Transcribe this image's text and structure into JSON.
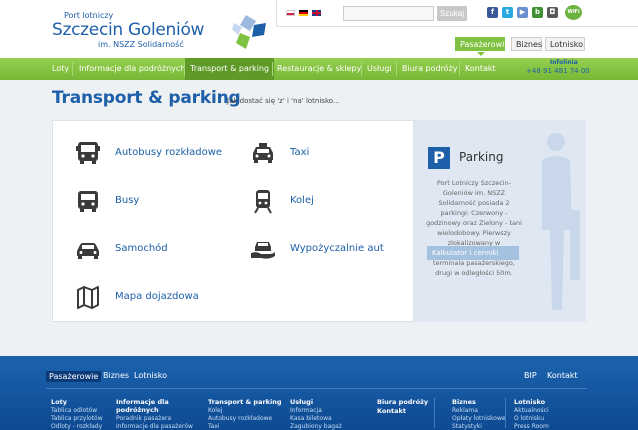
{
  "logo": {
    "line1": "Port lotniczy",
    "line2": "Szczecin Goleniów",
    "line3": "im. NSZZ Solidarność"
  },
  "topbar": {
    "search_placeholder": "",
    "search_button": "Szukaj",
    "social": [
      {
        "name": "facebook-icon",
        "glyph": "f",
        "color": "#3b5998"
      },
      {
        "name": "twitter-icon",
        "glyph": "t",
        "color": "#2aa9e0"
      },
      {
        "name": "youtube-icon",
        "glyph": "▶",
        "color": "#6a8fd0"
      },
      {
        "name": "blogger-icon",
        "glyph": "b",
        "color": "#3d9130"
      },
      {
        "name": "instagram-icon",
        "glyph": "◘",
        "color": "#5a5a5a"
      }
    ],
    "wifi_label": "WiFi"
  },
  "audience": {
    "passengers": "Pasażerowie",
    "business": "Biznes",
    "airport": "Lotnisko"
  },
  "nav": {
    "items": [
      "Loty",
      "Informacje dla podróżnych",
      "Transport & parking",
      "Restauracje & sklepy",
      "Usługi",
      "Biura podróży",
      "Kontakt"
    ],
    "infoline_label": "Infolinia",
    "infoline_phone": "+48 91 481 74 00"
  },
  "page": {
    "title": "Transport & parking",
    "subtitle": "Jak dostać się 'z' i 'na' lotnisko..."
  },
  "options": [
    {
      "label": "Autobusy rozkładowe",
      "icon": "bus-icon"
    },
    {
      "label": "Taxi",
      "icon": "taxi-icon"
    },
    {
      "label": "Busy",
      "icon": "minibus-icon"
    },
    {
      "label": "Kolej",
      "icon": "train-icon"
    },
    {
      "label": "Samochód",
      "icon": "car-icon"
    },
    {
      "label": "Wypożyczalnie aut",
      "icon": "car-rental-icon"
    },
    {
      "label": "Mapa dojazdowa",
      "icon": "map-icon"
    }
  ],
  "parking": {
    "badge": "P",
    "title": "Parking",
    "text": "Port Lotniczy Szczecin-Goleniów im. NSZZ Solidarność posiada 2 parkingi: Czerwony - godzinowy oraz Zielony - tani wielodobowy. Pierwszy zlokalizowany w bezpośrednim sąsiedztwie terminala pasażerskiego, drugi w odległości 50m.",
    "button": "Kalkulator i cenniki"
  },
  "footer": {
    "top_left": [
      "Pasażerowie",
      "Biznes",
      "Lotnisko"
    ],
    "top_right": [
      "BIP",
      "Kontakt"
    ],
    "columns": [
      {
        "title": "Loty",
        "items": [
          "Tablica odlotów",
          "Tablica przylotów",
          "Odloty - rozkłady"
        ]
      },
      {
        "title": "Informacje dla podróżnych",
        "items": [
          "Poradnik pasażera",
          "Informacje dla pasażerów"
        ]
      },
      {
        "title": "Transport & parking",
        "items": [
          "Kolej",
          "Autobusy rozkładowe",
          "Taxi"
        ]
      },
      {
        "title": "Usługi",
        "items": [
          "Informacja",
          "Kasa biletowa",
          "Zagubiony bagaż"
        ]
      },
      {
        "title": "Biura podróży",
        "items": []
      },
      {
        "title": "Kontakt",
        "items": []
      },
      {
        "title": "Biznes",
        "items": [
          "Reklama",
          "Opłaty lotniskowe",
          "Statystyki"
        ]
      },
      {
        "title": "Lotnisko",
        "items": [
          "Aktualności",
          "O lotnisku",
          "Press Room"
        ]
      }
    ]
  },
  "colors": {
    "brand_blue": "#1d5fa8",
    "nav_green": "#7fc241",
    "nav_active": "#5f9a28",
    "footer_blue": "#1c63ae"
  }
}
